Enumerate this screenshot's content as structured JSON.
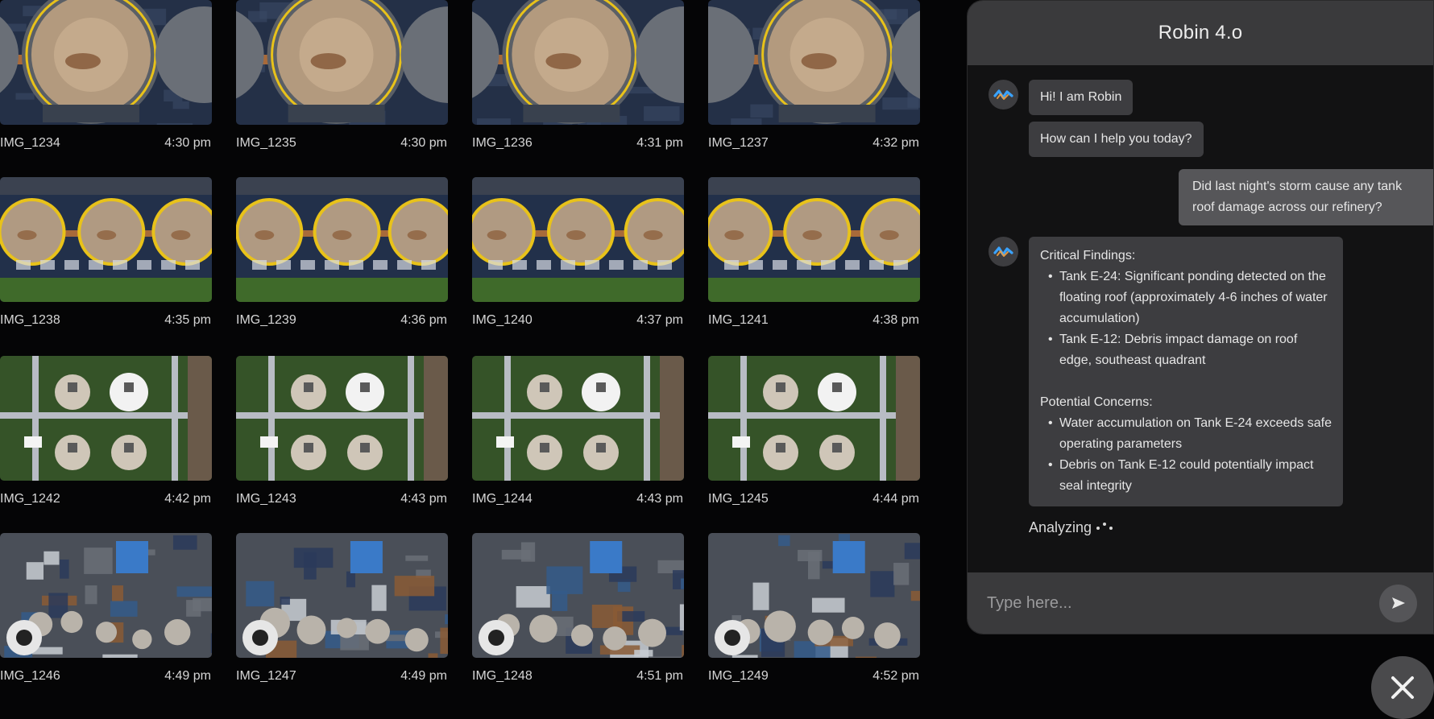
{
  "gallery": {
    "images": [
      {
        "name": "IMG_1234",
        "time": "4:30 pm",
        "scene": "tank-large"
      },
      {
        "name": "IMG_1235",
        "time": "4:30 pm",
        "scene": "tank-large"
      },
      {
        "name": "IMG_1236",
        "time": "4:31 pm",
        "scene": "tank-large"
      },
      {
        "name": "IMG_1237",
        "time": "4:32 pm",
        "scene": "tank-large"
      },
      {
        "name": "IMG_1238",
        "time": "4:35 pm",
        "scene": "tank-row"
      },
      {
        "name": "IMG_1239",
        "time": "4:36 pm",
        "scene": "tank-row"
      },
      {
        "name": "IMG_1240",
        "time": "4:37 pm",
        "scene": "tank-row"
      },
      {
        "name": "IMG_1241",
        "time": "4:38 pm",
        "scene": "tank-row"
      },
      {
        "name": "IMG_1242",
        "time": "4:42 pm",
        "scene": "spheres"
      },
      {
        "name": "IMG_1243",
        "time": "4:43 pm",
        "scene": "spheres"
      },
      {
        "name": "IMG_1244",
        "time": "4:43 pm",
        "scene": "spheres"
      },
      {
        "name": "IMG_1245",
        "time": "4:44 pm",
        "scene": "spheres"
      },
      {
        "name": "IMG_1246",
        "time": "4:49 pm",
        "scene": "plant"
      },
      {
        "name": "IMG_1247",
        "time": "4:49 pm",
        "scene": "plant"
      },
      {
        "name": "IMG_1248",
        "time": "4:51 pm",
        "scene": "plant"
      },
      {
        "name": "IMG_1249",
        "time": "4:52 pm",
        "scene": "plant"
      }
    ]
  },
  "chat": {
    "title": "Robin 4.o",
    "greeting_1": "Hi! I am Robin",
    "greeting_2": "How can I help you today?",
    "user_message": "Did last night's storm cause any tank roof damage across our refinery?",
    "critical_heading": "Critical Findings:",
    "critical_items": [
      "Tank E-24: Significant ponding detected on the floating roof (approximately 4-6 inches of water accumulation)",
      "Tank E-12: Debris impact damage on roof edge, southeast quadrant"
    ],
    "concerns_heading": "Potential Concerns:",
    "concern_items": [
      "Water accumulation on Tank E-24 exceeds safe operating parameters",
      "Debris on Tank E-12 could potentially impact seal integrity"
    ],
    "status": "Analyzing",
    "input_placeholder": "Type here..."
  },
  "icons": {
    "avatar": "robin-logo-icon",
    "send": "send-arrow-icon",
    "close": "close-icon"
  },
  "colors": {
    "logo_blue": "#3aa3ff",
    "logo_orange": "#f0a040",
    "tank_rim": "#e8c21a"
  }
}
